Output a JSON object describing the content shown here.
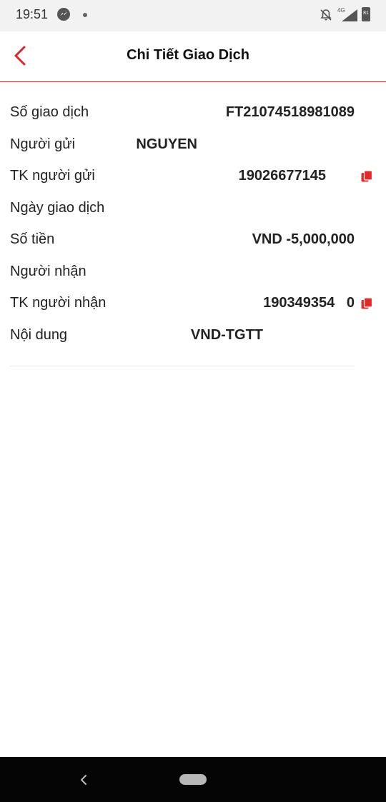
{
  "status_bar": {
    "time": "19:51",
    "network": "4G",
    "battery": "81",
    "icons": [
      "messenger-icon",
      "notification-dot-icon",
      "mute-bell-icon",
      "signal-icon",
      "battery-icon"
    ]
  },
  "header": {
    "title": "Chi Tiết Giao Dịch",
    "back_icon": "chevron-left-icon",
    "accent_color": "#d9262c"
  },
  "details": {
    "rows": [
      {
        "label": "Số giao dịch",
        "value": "FT21074518981089"
      },
      {
        "label": "Người gửi",
        "value": "NGUYEN"
      },
      {
        "label": "TK người gửi",
        "value": "19026677145",
        "copy_icon": "copy-icon"
      },
      {
        "label": "Ngày giao dịch",
        "value": ""
      },
      {
        "label": "Số tiền",
        "value": "VND -5,000,000"
      },
      {
        "label": "Người nhận",
        "value": ""
      },
      {
        "label": "TK người nhận",
        "value": "190349354   0",
        "copy_icon": "copy-icon"
      },
      {
        "label": "Nội dung",
        "value": "VND-TGTT"
      }
    ]
  },
  "nav_bar": {
    "icons": [
      "nav-back-icon",
      "nav-home-pill"
    ]
  }
}
